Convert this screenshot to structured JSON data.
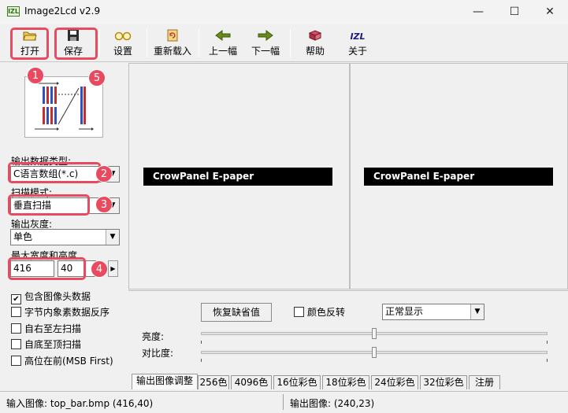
{
  "window": {
    "app_icon": "IZL",
    "title": "Image2Lcd v2.9",
    "controls": {
      "minimize": "—",
      "maximize": "☐",
      "close": "✕"
    }
  },
  "toolbar": {
    "open": "打开",
    "save": "保存",
    "settings": "设置",
    "reload": "重新载入",
    "prev": "上一幅",
    "next": "下一幅",
    "help": "帮助",
    "about": "关于",
    "icons": {
      "open": "open-folder-icon",
      "save": "floppy-disk-icon",
      "settings": "glasses-icon",
      "reload": "reload-icon",
      "prev": "left-arrow-icon",
      "next": "right-arrow-icon",
      "help": "help-book-icon",
      "about": "izl-logo-icon"
    },
    "about_glyph": "IZL"
  },
  "annotations": [
    "1",
    "2",
    "3",
    "4",
    "5"
  ],
  "left": {
    "output_type_label": "输出数据类型:",
    "output_type_value": "C语言数组(*.c)",
    "scan_mode_label": "扫描模式:",
    "scan_mode_value": "垂直扫描",
    "gray_label": "输出灰度:",
    "gray_value": "单色",
    "max_size_label": "最大宽度和高度",
    "max_width": "416",
    "max_height": "40",
    "checkboxes": [
      {
        "label": "包含图像头数据",
        "checked": true
      },
      {
        "label": "字节内象素数据反序",
        "checked": false
      },
      {
        "label": "自右至左扫描",
        "checked": false
      },
      {
        "label": "自底至顶扫描",
        "checked": false
      },
      {
        "label": "高位在前(MSB First)",
        "checked": false
      }
    ]
  },
  "preview": {
    "input_text": "CrowPanel E-paper",
    "output_text": "CrowPanel E-paper"
  },
  "adjust": {
    "restore_button": "恢复缺省值",
    "invert_label": "颜色反转",
    "display_mode": "正常显示",
    "brightness_label": "亮度:",
    "contrast_label": "对比度:",
    "brightness_level": 0.5,
    "contrast_level": 0.5
  },
  "tabs": [
    "输出图像调整",
    "256色",
    "4096色",
    "16位彩色",
    "18位彩色",
    "24位彩色",
    "32位彩色",
    "注册"
  ],
  "status": {
    "input": "输入图像: top_bar.bmp (416,40)",
    "output": "输出图像: (240,23)"
  },
  "colors": {
    "highlight": "#e84a5f",
    "preview_bar": "#000000"
  }
}
